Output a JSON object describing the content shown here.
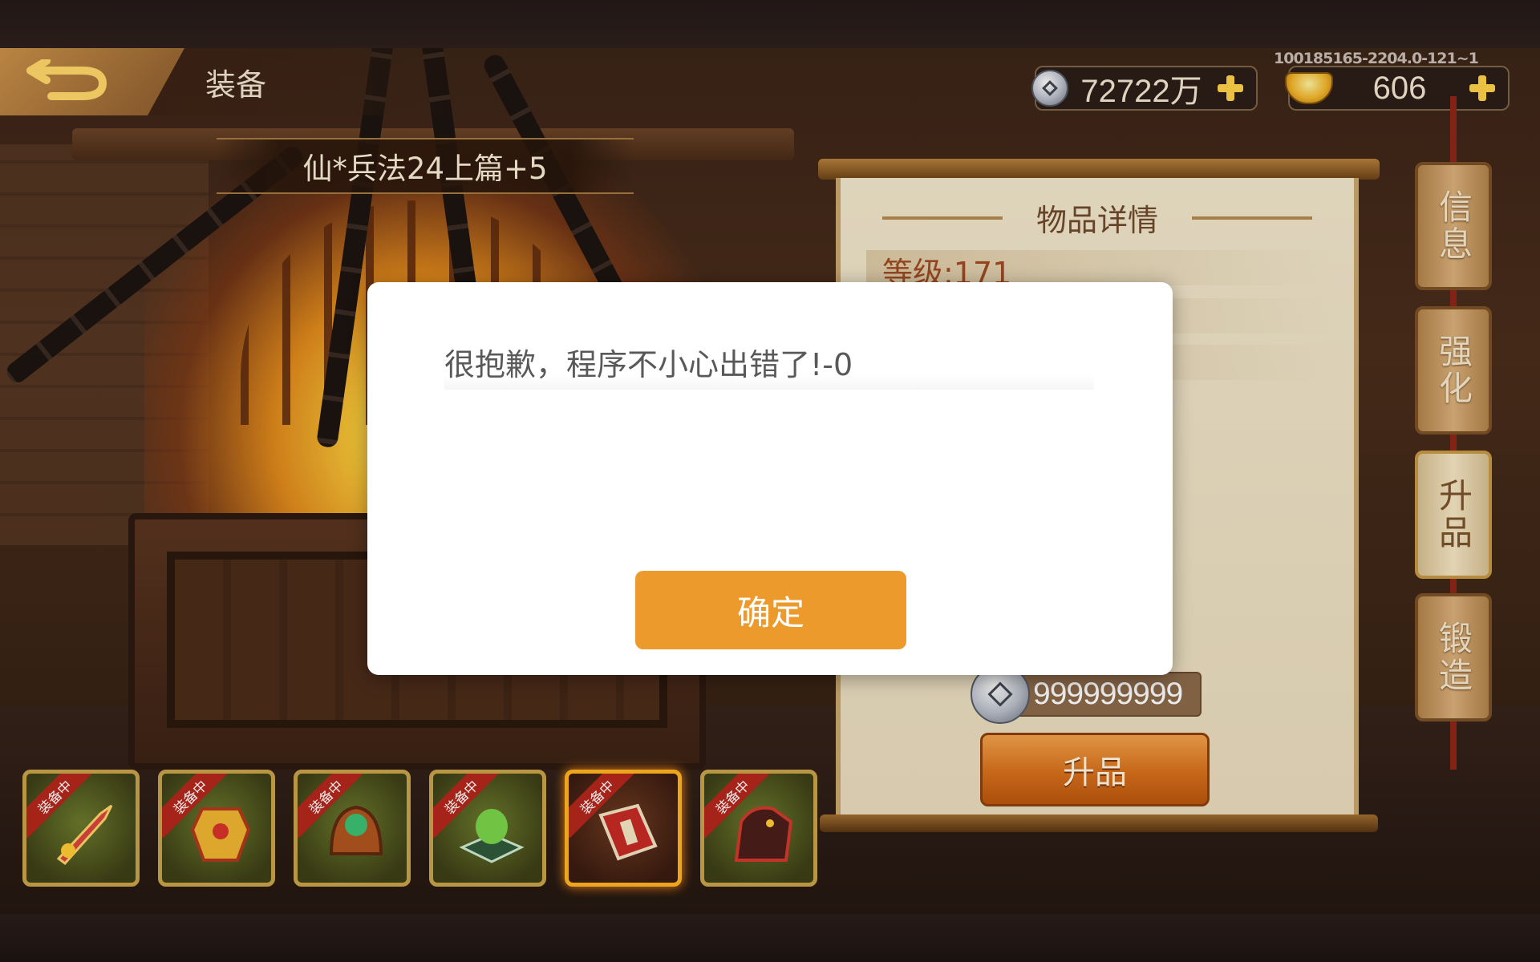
{
  "header": {
    "title": "装备",
    "item_name": "仙*兵法24上篇+5",
    "build_id": "100185165-2204.0-121~1"
  },
  "currency": {
    "silver": "72722万",
    "gold": "606"
  },
  "detail_panel": {
    "title": "物品详情",
    "level": "等级:171",
    "cost": "999999999",
    "upgrade_label": "升品"
  },
  "side_tabs": [
    {
      "label": "信息",
      "active": false
    },
    {
      "label": "强化",
      "active": false
    },
    {
      "label": "升品",
      "active": true
    },
    {
      "label": "锻造",
      "active": false
    }
  ],
  "equipment_slots": [
    {
      "badge": "装备中",
      "icon": "sword-icon"
    },
    {
      "badge": "装备中",
      "icon": "armor-icon"
    },
    {
      "badge": "装备中",
      "icon": "helmet-icon"
    },
    {
      "badge": "装备中",
      "icon": "jade-seal-icon"
    },
    {
      "badge": "装备中",
      "icon": "book-icon",
      "selected": true
    },
    {
      "badge": "装备中",
      "icon": "mount-icon"
    }
  ],
  "dialog": {
    "message": "很抱歉，程序不小心出错了!-0",
    "ok_label": "确定"
  },
  "colors": {
    "accent": "#ec9a2b",
    "badge_red": "#b3261b",
    "level_text": "#a14b22"
  }
}
